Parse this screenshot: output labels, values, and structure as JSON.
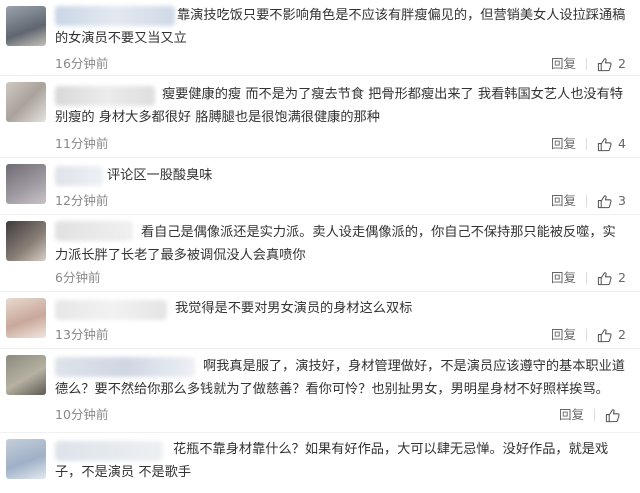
{
  "actions": {
    "reply_label": "回复",
    "like_icon": "thumbs-up-icon"
  },
  "comments": [
    {
      "text": "靠演技吃饭只要不影响角色是不应该有胖瘦偏见的，但营销美女人设拉踩通稿的女演员不要又当又立",
      "time": "16分钟前",
      "likes": "2"
    },
    {
      "text": "瘦要健康的瘦 而不是为了瘦去节食 把骨形都瘦出来了 我看韩国女艺人也没有特别瘦的 身材大多都很好 胳膊腿也是很饱满很健康的那种",
      "time": "11分钟前",
      "likes": "4"
    },
    {
      "text": "评论区一股酸臭味",
      "time": "12分钟前",
      "likes": "3"
    },
    {
      "text": "看自己是偶像派还是实力派。卖人设走偶像派的，你自己不保持那只能被反噬，实力派长胖了长老了最多被调侃没人会真喷你",
      "time": "6分钟前",
      "likes": "2"
    },
    {
      "text": "我觉得是不要对男女演员的身材这么双标",
      "time": "13分钟前",
      "likes": "2"
    },
    {
      "text": "啊我真是服了，演技好，身材管理做好，不是演员应该遵守的基本职业道德么？要不然给你那么多钱就为了做慈善？看你可怜？也别扯男女，男明星身材不好照样挨骂。",
      "time": "10分钟前",
      "likes": ""
    },
    {
      "text": "花瓶不靠身材靠什么？如果有好作品，大可以肆无忌惮。没好作品，就是戏子，不是演员 不是歌手",
      "time": "",
      "likes": ""
    }
  ]
}
